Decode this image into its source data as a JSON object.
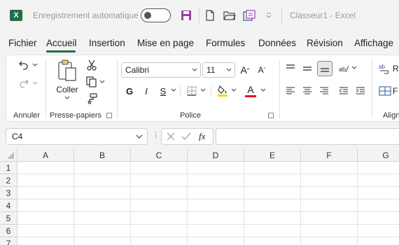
{
  "titlebar": {
    "autosave_label": "Enregistrement automatique",
    "autosave_state": "off",
    "doc_title": "Classeur1  -  Excel",
    "app_icon_letter": "X"
  },
  "menu": {
    "tabs": [
      "Fichier",
      "Accueil",
      "Insertion",
      "Mise en page",
      "Formules",
      "Données",
      "Révision",
      "Affichage"
    ],
    "active": "Accueil"
  },
  "ribbon": {
    "groups": {
      "undo": "Annuler",
      "clipboard": "Presse-papiers",
      "font": "Police",
      "alignment": "Align"
    },
    "paste_label": "Coller",
    "font_name": "Calibri",
    "font_size": "11",
    "bold_label": "G",
    "italic_label": "I",
    "underline_label": "S",
    "grow_font_label": "A",
    "shrink_font_label": "A",
    "font_color_label": "A",
    "font_color": "#e81123",
    "highlight_color": "#ffd700",
    "accent_color": "#1e7145"
  },
  "formula_bar": {
    "name_box_value": "C4",
    "fx_label": "fx",
    "formula_value": ""
  },
  "grid": {
    "columns": [
      "A",
      "B",
      "C",
      "D",
      "E",
      "F",
      "G"
    ],
    "rows": [
      "1",
      "2",
      "3",
      "4",
      "5",
      "6",
      "7"
    ],
    "selected_cell": "C4"
  }
}
